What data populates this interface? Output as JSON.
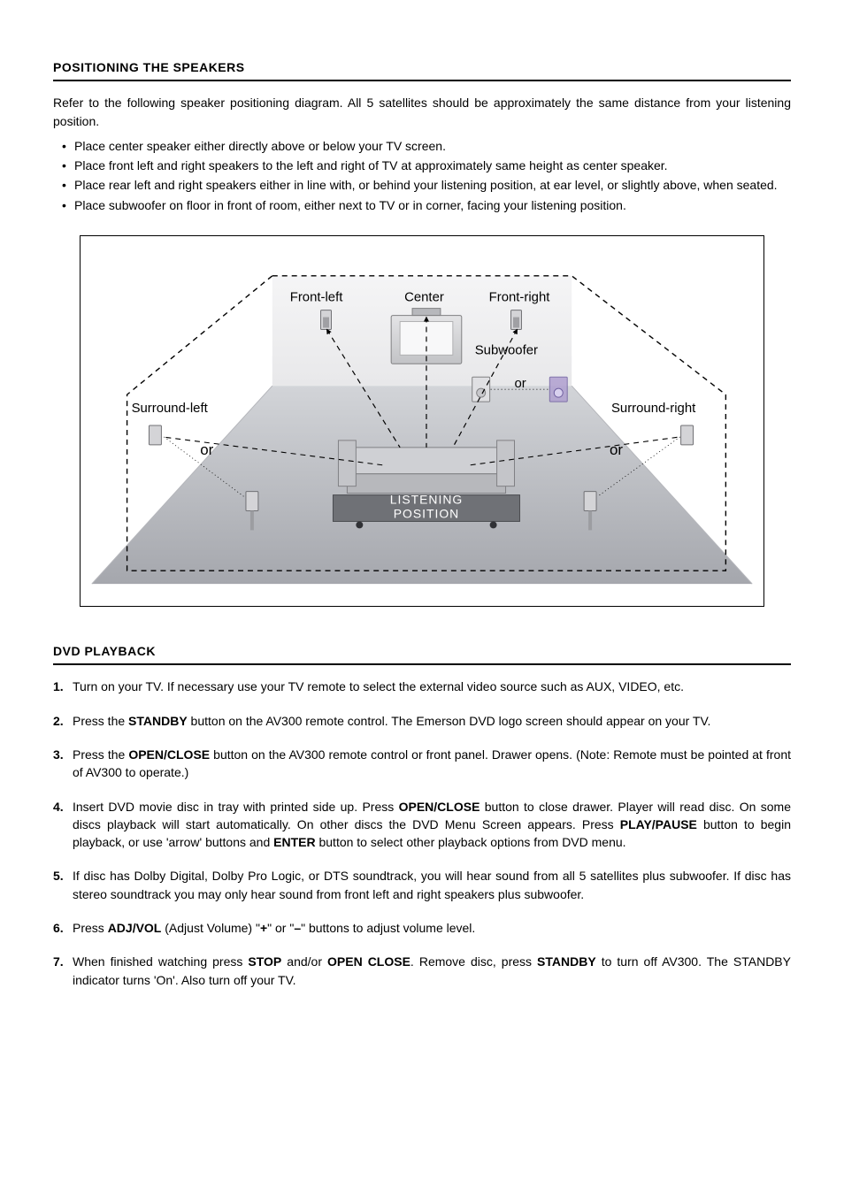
{
  "section1": {
    "heading": "POSITIONING THE SPEAKERS",
    "intro": "Refer to the following speaker positioning diagram. All 5 satellites should be approximately the same distance from your listening position.",
    "bullets": [
      "Place center speaker either directly above or below your TV screen.",
      "Place front left and right speakers to the left and right of TV at approximately same height as center speaker.",
      "Place rear left and right speakers either in line with, or behind your listening position, at ear level, or slightly above, when seated.",
      "Place subwoofer on floor in front of room, either next to TV or in corner, facing your listening position."
    ]
  },
  "diagram": {
    "labels": {
      "front_left": "Front-left",
      "center": "Center",
      "front_right": "Front-right",
      "subwoofer": "Subwoofer",
      "surround_left": "Surround-left",
      "surround_right": "Surround-right",
      "listening_position": "LISTENING\nPOSITION",
      "or": "or"
    }
  },
  "section2": {
    "heading": "DVD PLAYBACK",
    "steps_html": [
      "Turn on your TV. If necessary use your TV remote to select the external video source such as AUX, VIDEO, etc.",
      "Press the <b>STANDBY</b> button on the AV300 remote control. The Emerson DVD logo screen should appear on your TV.",
      "Press the <b>OPEN/CLOSE</b> button on the AV300 remote control or front panel. Drawer opens. (Note: Remote must be pointed at front of AV300 to operate.)",
      "Insert DVD movie disc in tray with printed side up. Press <b>OPEN/CLOSE</b> button to close drawer. Player will read disc. On some discs playback will start automatically. On other discs the DVD Menu Screen appears. Press <b>PLAY/PAUSE</b> button to begin playback, or use 'arrow' buttons and <b>ENTER</b> button to select other playback options from DVD menu.",
      "If disc has Dolby Digital, Dolby Pro Logic, or DTS soundtrack, you will hear sound from all 5 satellites plus subwoofer. If disc has stereo soundtrack you may only hear sound from front left and right speakers plus subwoofer.",
      "Press <b>ADJ/VOL</b> (Adjust Volume) \"<b>+</b>\" or \"<b>–</b>\" buttons to adjust volume level.",
      "When finished watching press <b>STOP</b> and/or <b>OPEN CLOSE</b>. Remove disc, press <b>STANDBY</b> to turn off AV300. The STANDBY indicator turns 'On'. Also turn off your TV."
    ]
  }
}
